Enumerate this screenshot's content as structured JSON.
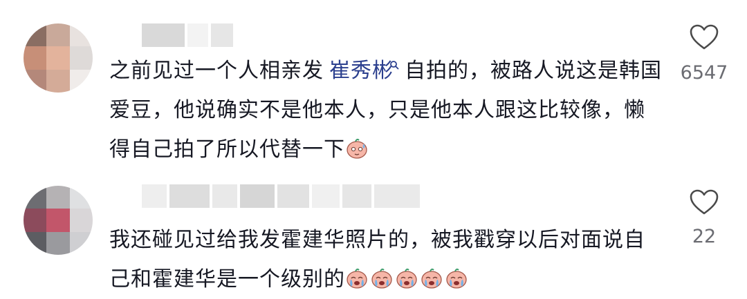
{
  "comments": [
    {
      "text_before": "之前见过一个人相亲发",
      "mention": "崔秀彬",
      "text_after": "自拍的，被路人说这是韩国爱豆，他说确实不是他本人，只是他本人跟这比较像，懒得自己拍了所以代替一下",
      "emojis": [
        "sweat-blush-emoji"
      ],
      "like_count": "6547"
    },
    {
      "text_before": "我还碰见过给我发霍建华照片的，被我戳穿以后对面说自己和霍建华是一个级别的",
      "mention": "",
      "text_after": "",
      "emojis": [
        "crying-emoji",
        "crying-emoji",
        "crying-emoji",
        "crying-emoji",
        "crying-emoji"
      ],
      "like_count": "22"
    }
  ],
  "colors": {
    "text": "#161823",
    "mention": "#2b3f8e",
    "like_count": "#6b6c72",
    "heart": "#4a4a4a"
  }
}
